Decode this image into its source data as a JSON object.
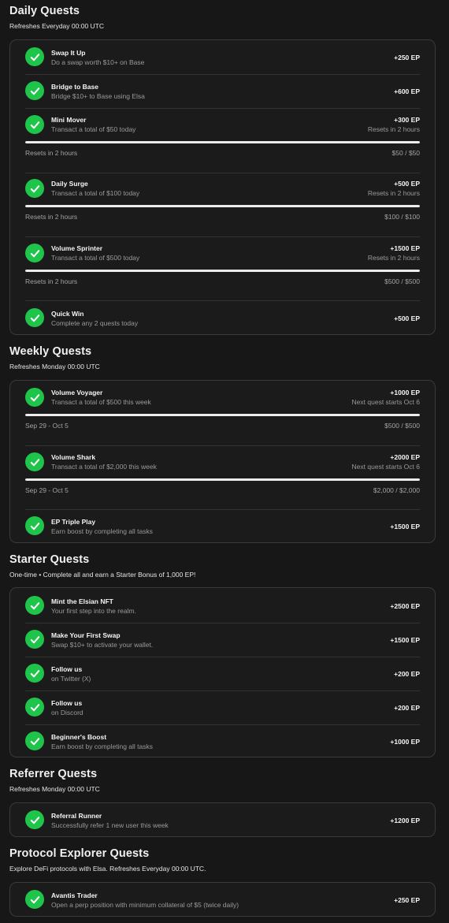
{
  "daily": {
    "title": "Daily Quests",
    "subtitle": "Refreshes Everyday 00:00 UTC",
    "quests": [
      {
        "title": "Swap It Up",
        "desc": "Do a swap worth $10+ on Base",
        "ep": "+250 EP"
      },
      {
        "title": "Bridge to Base",
        "desc": "Bridge $10+ to Base using Elsa",
        "ep": "+600 EP"
      },
      {
        "title": "Mini Mover",
        "desc": "Transact a total of $50 today",
        "ep": "+300 EP",
        "note": "Resets in 2 hours",
        "progress_left": "Resets in 2 hours",
        "progress_right": "$50 / $50",
        "progress": 1.0
      },
      {
        "title": "Daily Surge",
        "desc": "Transact a total of $100 today",
        "ep": "+500 EP",
        "note": "Resets in 2 hours",
        "progress_left": "Resets in 2 hours",
        "progress_right": "$100 / $100",
        "progress": 1.0
      },
      {
        "title": "Volume Sprinter",
        "desc": "Transact a total of $500 today",
        "ep": "+1500 EP",
        "note": "Resets in 2 hours",
        "progress_left": "Resets in 2 hours",
        "progress_right": "$500 / $500",
        "progress": 1.0
      },
      {
        "title": "Quick Win",
        "desc": "Complete any 2 quests today",
        "ep": "+500 EP"
      }
    ]
  },
  "weekly": {
    "title": "Weekly Quests",
    "subtitle": "Refreshes Monday 00:00 UTC",
    "quests": [
      {
        "title": "Volume Voyager",
        "desc": "Transact a total of $500 this week",
        "ep": "+1000 EP",
        "note": "Next quest starts Oct 6",
        "progress_left": "Sep 29 - Oct 5",
        "progress_right": "$500 / $500",
        "progress": 1.0
      },
      {
        "title": "Volume Shark",
        "desc": "Transact a total of $2,000 this week",
        "ep": "+2000 EP",
        "note": "Next quest starts Oct 6",
        "progress_left": "Sep 29 - Oct 5",
        "progress_right": "$2,000 / $2,000",
        "progress": 1.0
      },
      {
        "title": "EP Triple Play",
        "desc": "Earn boost by completing all tasks",
        "ep": "+1500 EP"
      }
    ]
  },
  "starter": {
    "title": "Starter Quests",
    "subtitle": "One-time • Complete all and earn a Starter Bonus of 1,000 EP!",
    "quests": [
      {
        "title": "Mint the Elsian NFT",
        "desc": "Your first step into the realm.",
        "ep": "+2500 EP"
      },
      {
        "title": "Make Your First Swap",
        "desc": "Swap $10+ to activate your wallet.",
        "ep": "+1500 EP"
      },
      {
        "title": "Follow us",
        "desc": "on Twitter (X)",
        "ep": "+200 EP"
      },
      {
        "title": "Follow us",
        "desc": "on Discord",
        "ep": "+200 EP"
      },
      {
        "title": "Beginner's Boost",
        "desc": "Earn boost by completing all tasks",
        "ep": "+1000 EP"
      }
    ]
  },
  "referrer": {
    "title": "Referrer Quests",
    "subtitle": "Refreshes Monday 00:00 UTC",
    "quests": [
      {
        "title": "Referral Runner",
        "desc": "Successfully refer 1 new user this week",
        "ep": "+1200 EP"
      }
    ]
  },
  "protocol": {
    "title": "Protocol Explorer Quests",
    "subtitle": "Explore DeFi protocols with Elsa. Refreshes Everyday 00:00 UTC.",
    "quests": [
      {
        "title": "Avantis Trader",
        "desc": "Open a perp position with minimum collateral of $5 (twice daily)",
        "ep": "+250 EP"
      }
    ]
  },
  "icons": {
    "check": "check-circle-icon"
  },
  "colors": {
    "accent": "#1fc44a",
    "background": "#171717",
    "card": "#1b1b1c"
  }
}
